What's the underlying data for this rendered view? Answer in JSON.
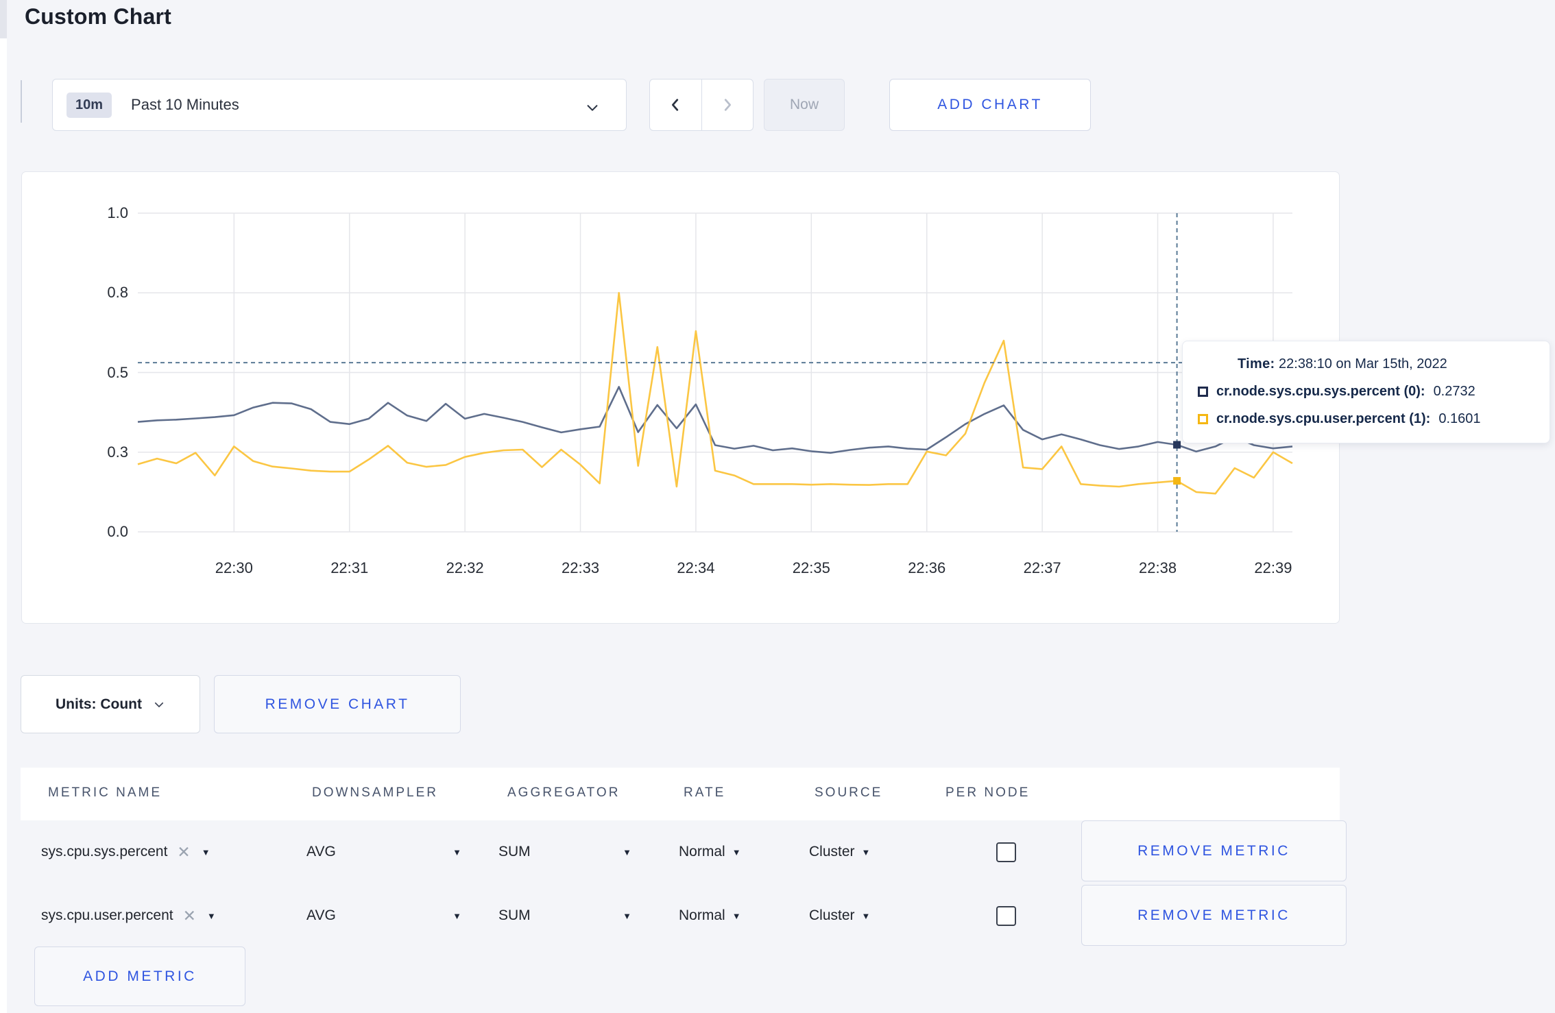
{
  "page": {
    "title": "Custom Chart"
  },
  "toolbar": {
    "range_badge": "10m",
    "range_label": "Past 10 Minutes",
    "prev_label": "previous time window",
    "next_label": "next time window",
    "now_label": "Now",
    "add_chart_label": "ADD CHART"
  },
  "chart_controls": {
    "units_label": "Units: Count",
    "remove_chart_label": "REMOVE CHART"
  },
  "tooltip": {
    "time_label": "Time:",
    "time_value": "22:38:10 on Mar 15th, 2022",
    "rows": [
      {
        "name": "cr.node.sys.cpu.sys.percent (0):",
        "value": "0.2732",
        "color": "#1f2b4d"
      },
      {
        "name": "cr.node.sys.cpu.user.percent (1):",
        "value": "0.1601",
        "color": "#f5b713"
      }
    ]
  },
  "metrics_table": {
    "headers": [
      "METRIC NAME",
      "DOWNSAMPLER",
      "AGGREGATOR",
      "RATE",
      "SOURCE",
      "PER NODE"
    ],
    "remove_metric_label": "REMOVE METRIC",
    "add_metric_label": "ADD METRIC",
    "rows": [
      {
        "name": "sys.cpu.sys.percent",
        "downsampler": "AVG",
        "aggregator": "SUM",
        "rate": "Normal",
        "source": "Cluster",
        "per_node_checked": false
      },
      {
        "name": "sys.cpu.user.percent",
        "downsampler": "AVG",
        "aggregator": "SUM",
        "rate": "Normal",
        "source": "Cluster",
        "per_node_checked": false
      }
    ]
  },
  "chart_data": {
    "type": "line",
    "title": "",
    "xlabel": "",
    "ylabel": "",
    "y_domain": [
      0,
      1
    ],
    "grid": true,
    "x_start_time": "22:29:10",
    "x_interval_seconds": 10,
    "y_ticks": [
      {
        "v": 0,
        "label": "0.0"
      },
      {
        "v": 0.25,
        "label": "0.3"
      },
      {
        "v": 0.5,
        "label": "0.5"
      },
      {
        "v": 0.75,
        "label": "0.8"
      },
      {
        "v": 1,
        "label": "1.0"
      }
    ],
    "x_ticks": [
      {
        "t": 60,
        "label": "22:30"
      },
      {
        "t": 120,
        "label": "22:31"
      },
      {
        "t": 180,
        "label": "22:32"
      },
      {
        "t": 240,
        "label": "22:33"
      },
      {
        "t": 300,
        "label": "22:34"
      },
      {
        "t": 360,
        "label": "22:35"
      },
      {
        "t": 420,
        "label": "22:36"
      },
      {
        "t": 480,
        "label": "22:37"
      },
      {
        "t": 540,
        "label": "22:38"
      },
      {
        "t": 600,
        "label": "22:39"
      }
    ],
    "t_domain": [
      10,
      610
    ],
    "series": [
      {
        "name": "cr.node.sys.cpu.sys.percent",
        "color": "#5f6e8c",
        "values": [
          0.345,
          0.35,
          0.352,
          0.356,
          0.36,
          0.366,
          0.39,
          0.405,
          0.403,
          0.385,
          0.345,
          0.338,
          0.355,
          0.405,
          0.365,
          0.348,
          0.402,
          0.355,
          0.37,
          0.358,
          0.345,
          0.328,
          0.312,
          0.322,
          0.33,
          0.455,
          0.313,
          0.398,
          0.325,
          0.4,
          0.272,
          0.261,
          0.27,
          0.256,
          0.262,
          0.253,
          0.248,
          0.257,
          0.264,
          0.268,
          0.261,
          0.258,
          0.297,
          0.338,
          0.37,
          0.397,
          0.32,
          0.29,
          0.306,
          0.29,
          0.272,
          0.26,
          0.268,
          0.282,
          0.2732,
          0.252,
          0.268,
          0.298,
          0.272,
          0.262,
          0.268
        ]
      },
      {
        "name": "cr.node.sys.cpu.user.percent",
        "color": "#fbc643",
        "values": [
          0.212,
          0.23,
          0.215,
          0.248,
          0.177,
          0.268,
          0.222,
          0.205,
          0.199,
          0.192,
          0.189,
          0.189,
          0.227,
          0.27,
          0.217,
          0.204,
          0.21,
          0.235,
          0.248,
          0.256,
          0.258,
          0.203,
          0.258,
          0.211,
          0.152,
          0.75,
          0.207,
          0.58,
          0.142,
          0.63,
          0.192,
          0.177,
          0.15,
          0.15,
          0.15,
          0.148,
          0.15,
          0.148,
          0.147,
          0.15,
          0.15,
          0.252,
          0.24,
          0.308,
          0.468,
          0.6,
          0.202,
          0.197,
          0.268,
          0.15,
          0.145,
          0.142,
          0.15,
          0.155,
          0.1601,
          0.125,
          0.12,
          0.2,
          0.17,
          0.25,
          0.215
        ]
      }
    ],
    "crosshair": {
      "t": 550,
      "time": "22:38:10",
      "y_value": 0.531,
      "marker_values": [
        0.2732,
        0.1601
      ],
      "marker_colors": [
        "#27375c",
        "#f5b713"
      ],
      "color": "#5a7a96"
    },
    "gridline_color": "#e5e6ea",
    "legend_position": "none"
  }
}
